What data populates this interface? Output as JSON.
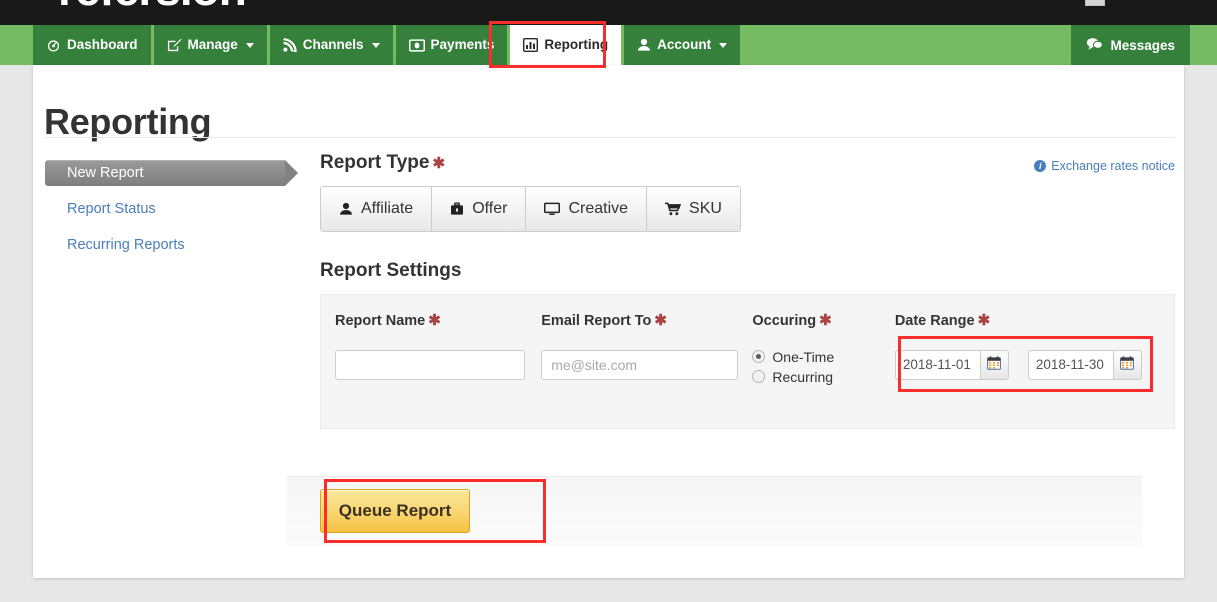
{
  "brand": {
    "name": "refersion"
  },
  "topnav": {
    "items": [
      {
        "label": "Dashboard",
        "icon": "dashboard-icon",
        "caret": false,
        "active": false
      },
      {
        "label": "Manage",
        "icon": "edit-icon",
        "caret": true,
        "active": false
      },
      {
        "label": "Channels",
        "icon": "rss-icon",
        "caret": true,
        "active": false
      },
      {
        "label": "Payments",
        "icon": "money-icon",
        "caret": false,
        "active": false
      },
      {
        "label": "Reporting",
        "icon": "bar-chart-icon",
        "caret": false,
        "active": true
      },
      {
        "label": "Account",
        "icon": "user-icon",
        "caret": true,
        "active": false
      }
    ],
    "messages_label": "Messages",
    "messages_icon": "chat-icon"
  },
  "page": {
    "title": "Reporting"
  },
  "sidebar": {
    "items": [
      {
        "label": "New Report",
        "active": true
      },
      {
        "label": "Report Status",
        "active": false
      },
      {
        "label": "Recurring Reports",
        "active": false
      }
    ]
  },
  "exchange_notice": {
    "label": "Exchange rates notice",
    "icon": "info-icon",
    "badge": "i"
  },
  "report_type": {
    "heading": "Report Type",
    "required_marker": "✱",
    "buttons": [
      {
        "label": "Affiliate",
        "icon": "user-icon"
      },
      {
        "label": "Offer",
        "icon": "briefcase-icon"
      },
      {
        "label": "Creative",
        "icon": "monitor-icon"
      },
      {
        "label": "SKU",
        "icon": "cart-icon"
      }
    ]
  },
  "report_settings": {
    "heading": "Report Settings",
    "required_marker": "✱",
    "report_name": {
      "label": "Report Name",
      "value": "",
      "placeholder": ""
    },
    "email_report_to": {
      "label": "Email Report To",
      "value": "",
      "placeholder": "me@site.com"
    },
    "occuring": {
      "label": "Occuring",
      "options": [
        {
          "label": "One-Time",
          "selected": true
        },
        {
          "label": "Recurring",
          "selected": false
        }
      ]
    },
    "date_range": {
      "label": "Date Range",
      "start": "2018-11-01",
      "end": "2018-11-30",
      "calendar_icon": "calendar-icon"
    }
  },
  "submit": {
    "queue_label": "Queue Report"
  },
  "annotations": {
    "color": "#f92d2d",
    "boxes": [
      "reporting-tab",
      "date-range",
      "queue-report-button"
    ]
  }
}
